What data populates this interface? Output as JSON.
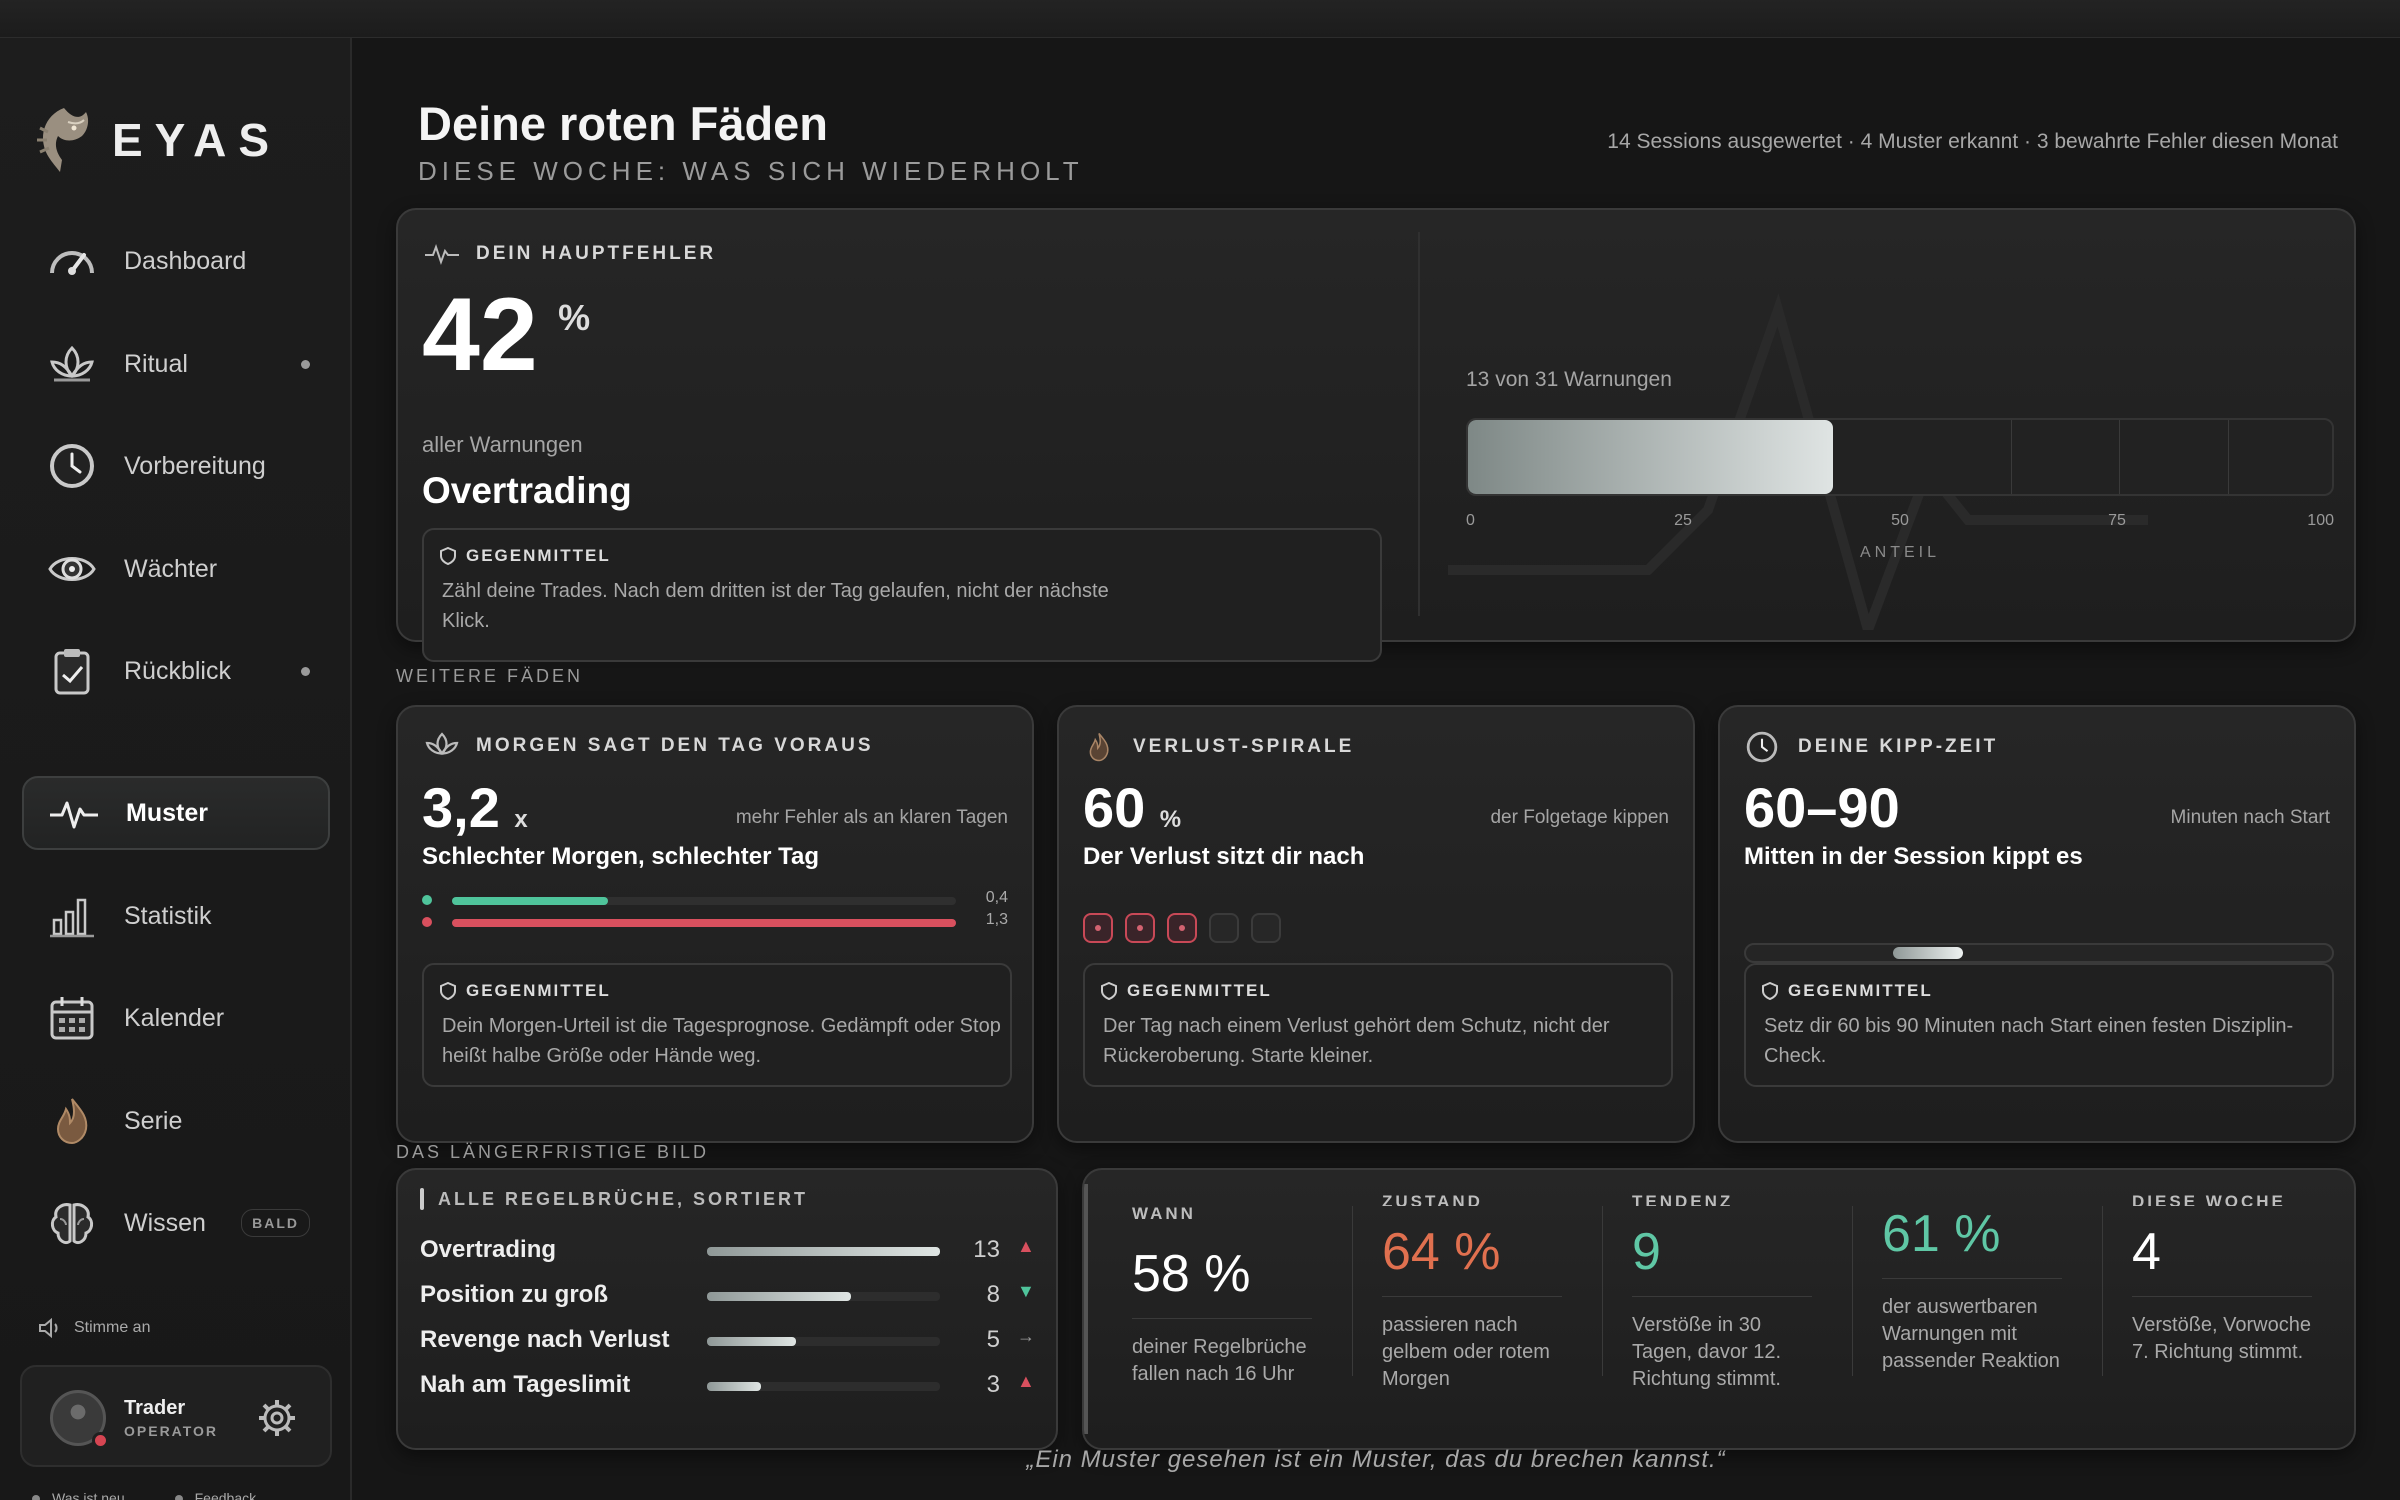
{
  "app": {
    "name": "EYAS"
  },
  "sidebar": {
    "items": [
      {
        "label": "Dashboard",
        "icon": "gauge-icon"
      },
      {
        "label": "Ritual",
        "icon": "lotus-icon",
        "dot": true
      },
      {
        "label": "Vorbereitung",
        "icon": "clock-icon"
      },
      {
        "label": "Wächter",
        "icon": "eye-icon"
      },
      {
        "label": "Rückblick",
        "icon": "clipboard-check-icon",
        "dot": true
      },
      {
        "label": "Muster",
        "icon": "pulse-icon",
        "active": true
      },
      {
        "label": "Statistik",
        "icon": "bar-chart-icon"
      },
      {
        "label": "Kalender",
        "icon": "calendar-icon"
      },
      {
        "label": "Serie",
        "icon": "flame-icon"
      },
      {
        "label": "Wissen",
        "icon": "brain-icon",
        "badge": "BALD"
      }
    ],
    "voice_label": "Stimme an",
    "user": {
      "name": "Trader",
      "role": "OPERATOR"
    },
    "footer": {
      "whats_new": "Was ist neu",
      "feedback": "Feedback"
    }
  },
  "header": {
    "title": "Deine roten Fäden",
    "subtitle": "DIESE WOCHE: WAS SICH WIEDERHOLT",
    "stats": "14 Sessions ausgewertet · 4 Muster erkannt · 3 bewahrte Fehler diesen Monat"
  },
  "main_error": {
    "caption": "DEIN HAUPTFEHLER",
    "value": "42",
    "unit": "%",
    "value_label": "aller Warnungen",
    "name": "Overtrading",
    "remedy_title": "GEGENMITTEL",
    "remedy_text": "Zähl deine Trades. Nach dem dritten ist der Tag gelaufen, nicht der nächste Klick.",
    "share_text": "13 von 31 Warnungen",
    "share_fraction": 0.42,
    "ticks": [
      "0",
      "25",
      "50",
      "75",
      "100"
    ],
    "axis_label": "ANTEIL"
  },
  "section_more": "WEITERE FÄDEN",
  "threads": [
    {
      "caption": "MORGEN SAGT DEN TAG VORAUS",
      "icon": "lotus-icon",
      "value": "3,2",
      "unit": "x",
      "note": "mehr Fehler als an klaren Tagen",
      "headline": "Schlechter Morgen, schlechter Tag",
      "bars": [
        {
          "value": "0,4",
          "fraction": 0.31,
          "color": "#4fc49b"
        },
        {
          "value": "1,3",
          "fraction": 1.0,
          "color": "#d9505e"
        }
      ],
      "remedy_title": "GEGENMITTEL",
      "remedy_text": "Dein Morgen-Urteil ist die Tagesprognose. Gedämpft oder Stop heißt halbe Größe oder Hände weg."
    },
    {
      "caption": "VERLUST-SPIRALE",
      "icon": "flame-icon",
      "value": "60",
      "unit": "%",
      "note": "der Folgetage kippen",
      "headline": "Der Verlust sitzt dir nach",
      "days_marked": 3,
      "days_total": 5,
      "remedy_title": "GEGENMITTEL",
      "remedy_text": "Der Tag nach einem Verlust gehört dem Schutz, nicht der Rückeroberung. Starte kleiner."
    },
    {
      "caption": "DEINE KIPP-ZEIT",
      "icon": "clock-icon",
      "value": "60–90",
      "unit": "",
      "note": "Minuten nach Start",
      "headline": "Mitten in der Session kippt es",
      "window_start": 0.25,
      "window_end": 0.37,
      "remedy_title": "GEGENMITTEL",
      "remedy_text": "Setz dir 60 bis 90 Minuten nach Start einen festen Disziplin-Check."
    }
  ],
  "section_long": "DAS LÄNGERFRISTIGE BILD",
  "rule_breaks": {
    "caption": "ALLE REGELBRÜCHE, SORTIERT",
    "items": [
      {
        "label": "Overtrading",
        "value": "13",
        "trend": "▲",
        "trend_color": "#d9505e",
        "fraction": 1.0
      },
      {
        "label": "Position zu groß",
        "value": "8",
        "trend": "▼",
        "trend_color": "#4fc49b",
        "fraction": 0.62
      },
      {
        "label": "Revenge nach Verlust",
        "value": "5",
        "trend": "→",
        "trend_color": "#9a9a9a",
        "fraction": 0.38
      },
      {
        "label": "Nah am Tageslimit",
        "value": "3",
        "trend": "▲",
        "trend_color": "#d9505e",
        "fraction": 0.23
      }
    ]
  },
  "long_stats": [
    {
      "caption": "WANN",
      "value": "58 %",
      "color": "#ffffff",
      "desc": "deiner Regelbrüche fallen nach 16 Uhr"
    },
    {
      "caption": "ZUSTAND",
      "value": "64 %",
      "color": "#e0704f",
      "desc": "passieren nach gelbem oder rotem Morgen"
    },
    {
      "caption": "TENDENZ",
      "value": "9",
      "color": "#5fc7a5",
      "desc": "Verstöße in 30 Tagen, davor 12. Richtung stimmt."
    },
    {
      "caption": "",
      "value": "61 %",
      "color": "#5fc7a5",
      "desc": "der auswertbaren Warnungen mit passender Reaktion"
    },
    {
      "caption": "DIESE WOCHE",
      "value": "4",
      "color": "#ffffff",
      "desc": "Verstöße, Vorwoche 7. Richtung stimmt."
    }
  ],
  "quote": "„Ein Muster gesehen ist ein Muster, das du brechen kannst.“"
}
